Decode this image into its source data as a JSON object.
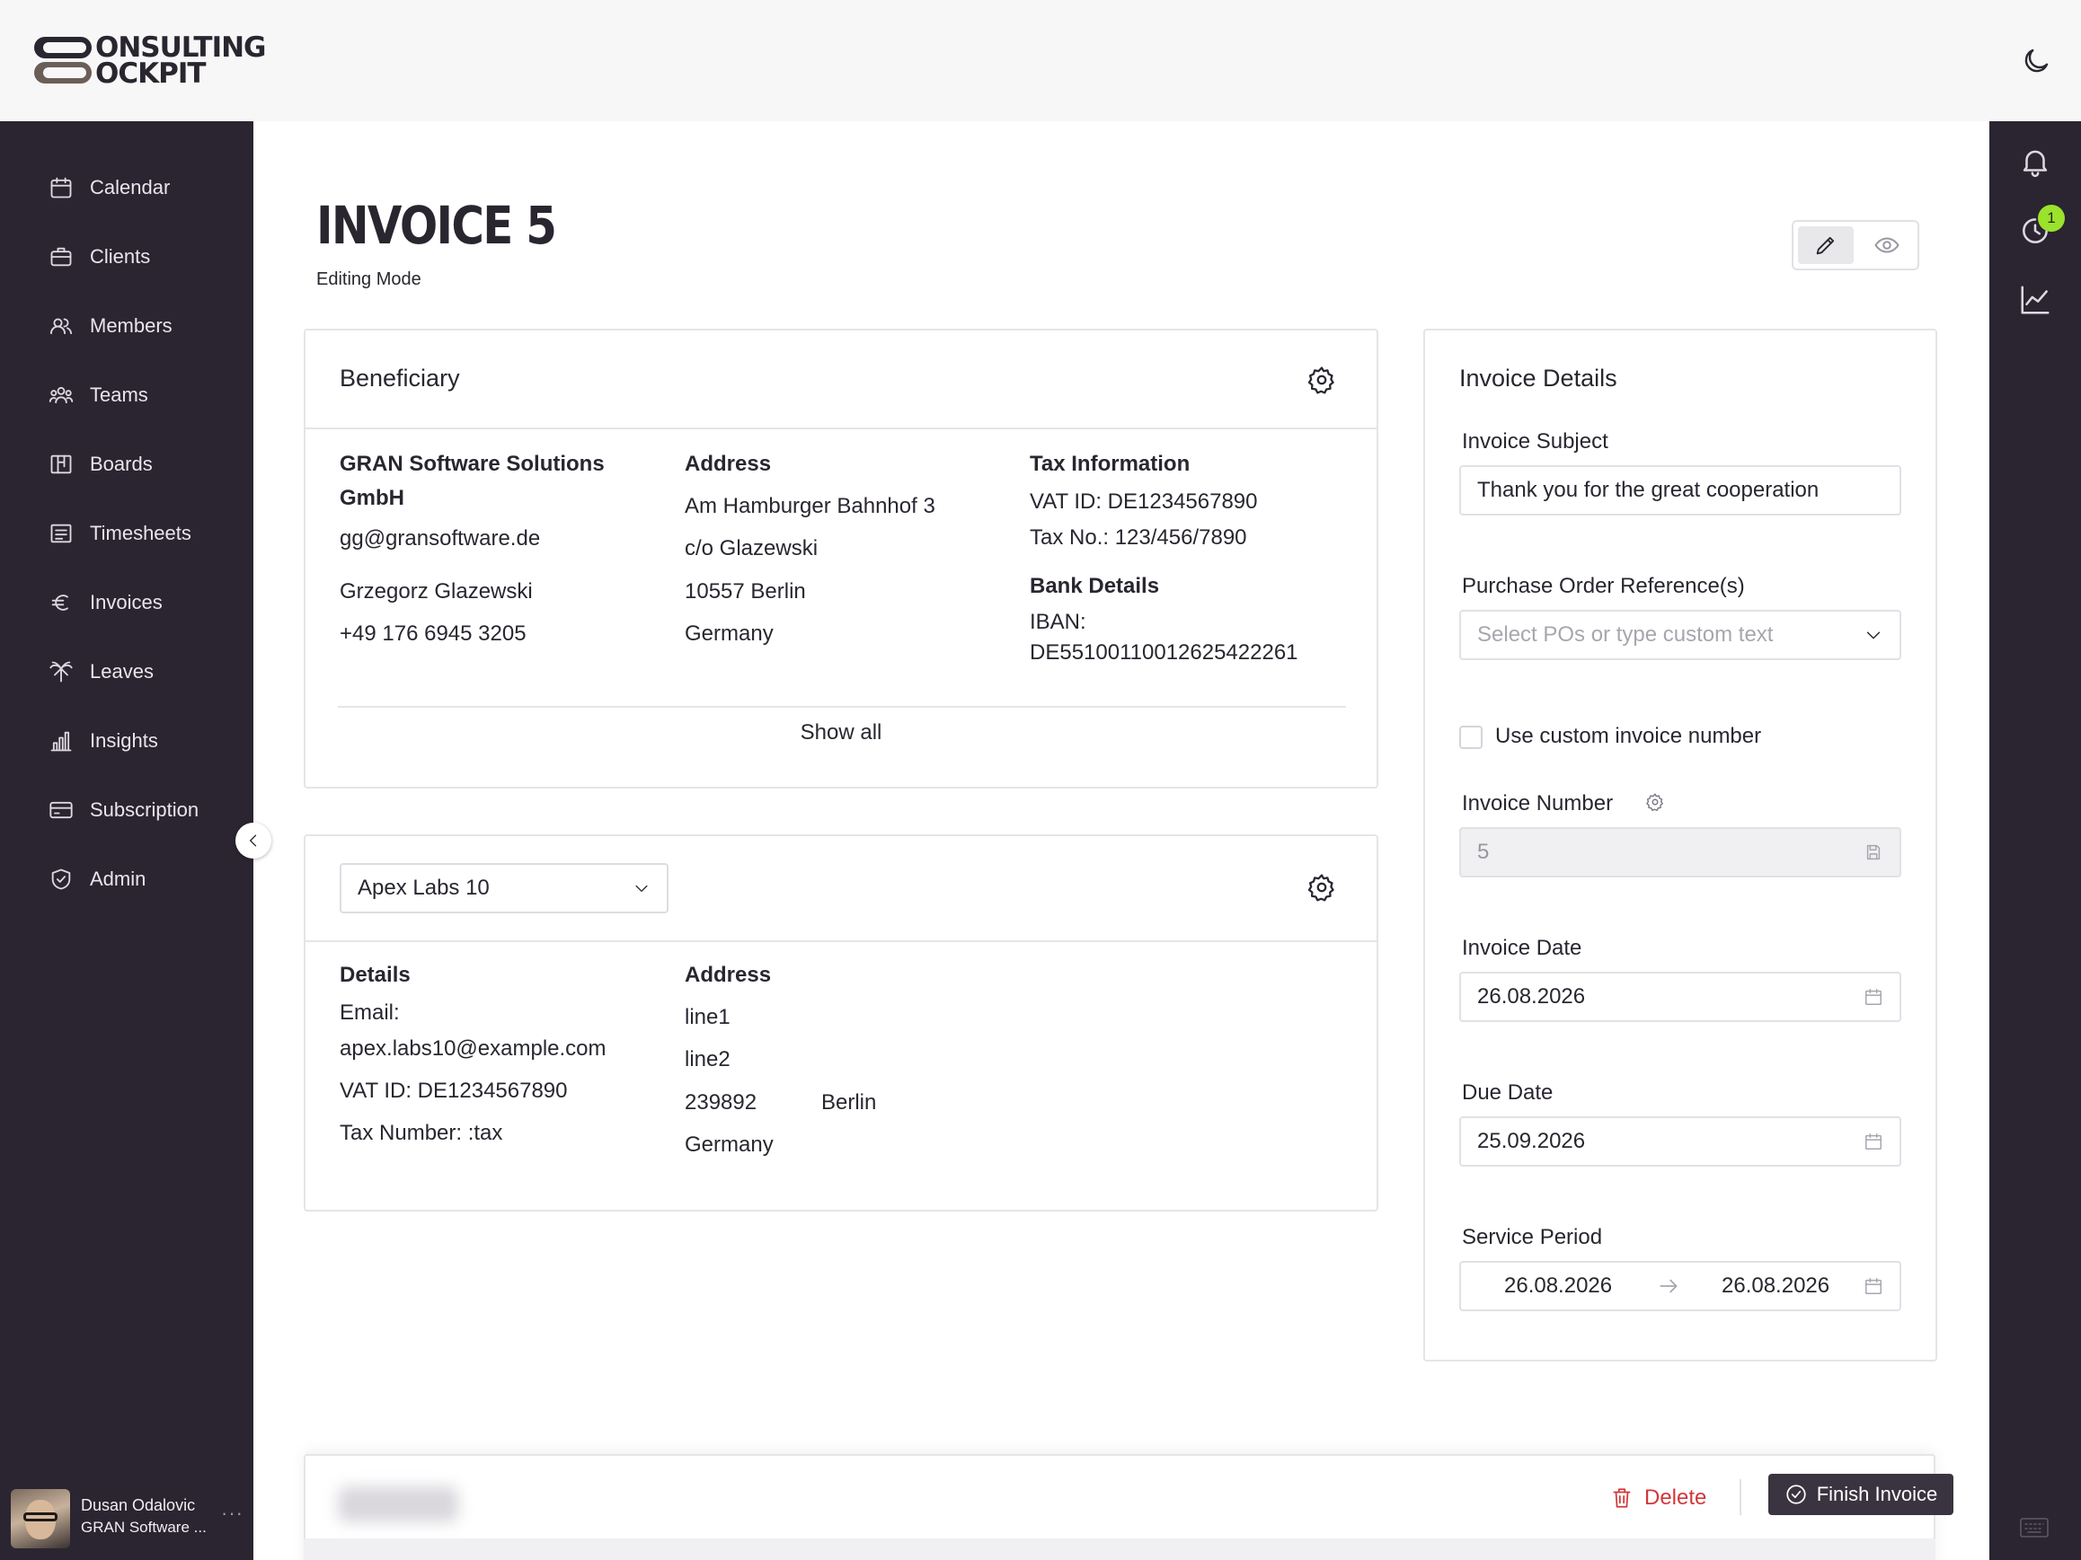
{
  "app": {
    "logo_line1": "ONSULTING",
    "logo_line2": "OCKPIT"
  },
  "sidebar": {
    "items": [
      {
        "label": "Calendar",
        "icon": "calendar-icon"
      },
      {
        "label": "Clients",
        "icon": "briefcase-icon"
      },
      {
        "label": "Members",
        "icon": "members-icon"
      },
      {
        "label": "Teams",
        "icon": "teams-icon"
      },
      {
        "label": "Boards",
        "icon": "boards-icon"
      },
      {
        "label": "Timesheets",
        "icon": "timesheets-icon"
      },
      {
        "label": "Invoices",
        "icon": "euro-icon"
      },
      {
        "label": "Leaves",
        "icon": "palm-tree-icon"
      },
      {
        "label": "Insights",
        "icon": "bar-chart-icon"
      },
      {
        "label": "Subscription",
        "icon": "card-icon"
      },
      {
        "label": "Admin",
        "icon": "shield-icon"
      }
    ],
    "user": {
      "name": "Dusan Odalovic",
      "org": "GRAN Software ...",
      "more": "···"
    }
  },
  "rail": {
    "notifications_badge": "1"
  },
  "page": {
    "title": "INVOICE 5",
    "subtitle": "Editing Mode"
  },
  "beneficiary": {
    "title": "Beneficiary",
    "company_line1": "GRAN Software Solutions",
    "company_line2": "GmbH",
    "email": "gg@gransoftware.de",
    "contact": "Grzegorz Glazewski",
    "phone": "+49 176 6945 3205",
    "address_heading": "Address",
    "address_lines": [
      "Am Hamburger Bahnhof 3",
      "c/o Glazewski",
      "10557 Berlin",
      "Germany"
    ],
    "tax_heading": "Tax Information",
    "vat_id": "VAT ID: DE1234567890",
    "tax_no": "Tax No.: 123/456/7890",
    "bank_heading": "Bank Details",
    "iban_label": "IBAN:",
    "iban_value": "DE55100110012625422261",
    "show_all": "Show all"
  },
  "client": {
    "selected": "Apex Labs 10",
    "details_heading": "Details",
    "email_label": "Email:",
    "email": "apex.labs10@example.com",
    "vat_id": "VAT ID: DE1234567890",
    "tax_number": "Tax Number: :tax",
    "address_heading": "Address",
    "line1": "line1",
    "line2": "line2",
    "zip": "239892",
    "city": "Berlin",
    "country": "Germany"
  },
  "invoice_details": {
    "title": "Invoice Details",
    "subject_label": "Invoice Subject",
    "subject_value": "Thank you for the great cooperation",
    "po_label": "Purchase Order Reference(s)",
    "po_placeholder": "Select POs or type custom text",
    "custom_number_label": "Use custom invoice number",
    "number_label": "Invoice Number",
    "number_value": "5",
    "date_label": "Invoice Date",
    "date_value": "26.08.2026",
    "due_label": "Due Date",
    "due_value": "25.09.2026",
    "period_label": "Service Period",
    "period_start": "26.08.2026",
    "period_end": "26.08.2026"
  },
  "actions": {
    "delete": "Delete",
    "finish": "Finish Invoice"
  }
}
